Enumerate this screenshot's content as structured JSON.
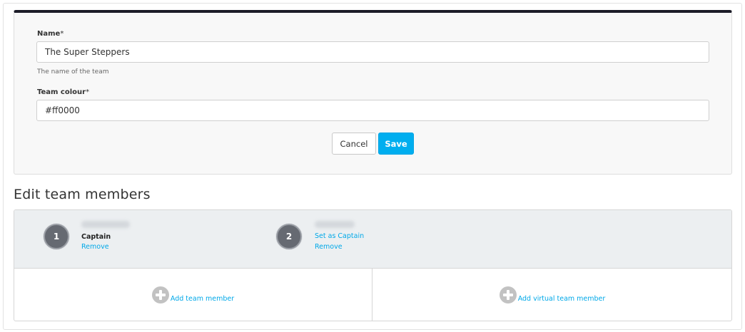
{
  "form": {
    "name_label": "Name",
    "name_required": "*",
    "name_value": "The Super Steppers",
    "name_help": "The name of the team",
    "colour_label": "Team colour",
    "colour_required": "*",
    "colour_value": "#ff0000",
    "cancel_label": "Cancel",
    "save_label": "Save"
  },
  "members_section": {
    "title": "Edit team members",
    "members": [
      {
        "number": "1",
        "status": "Captain",
        "remove_label": "Remove"
      },
      {
        "number": "2",
        "set_captain_label": "Set as Captain",
        "remove_label": "Remove"
      }
    ],
    "add_member_label": "Add team member",
    "add_virtual_member_label": "Add virtual team member"
  },
  "colors": {
    "accent": "#00aeef",
    "link": "#00a8e8",
    "header_bar": "#1c1c28",
    "badge": "#666a72"
  },
  "icons": [
    "plus-circle-icon"
  ]
}
